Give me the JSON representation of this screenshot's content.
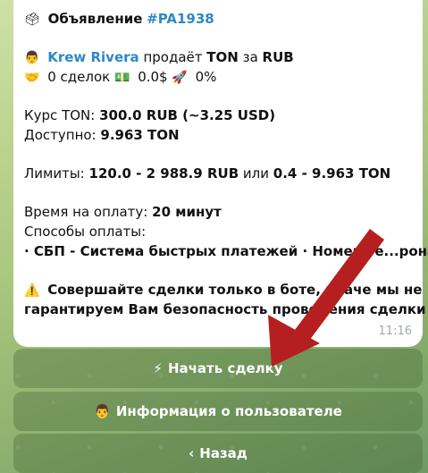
{
  "message": {
    "title_emoji": "🗳",
    "title_text": "Объявление",
    "title_tag": "#PA1938",
    "seller_emoji": "👨",
    "seller_name": "Krew Rivera",
    "sells_word": "продаёт",
    "currency": "TON",
    "for_word": "за",
    "fiat": "RUB",
    "stats_emoji": "🤝",
    "deals": "0 сделок",
    "volume_emoji": "💵",
    "volume": "0.0$",
    "rocket_emoji": "🚀",
    "rating": "0%",
    "rate_label": "Курс TON:",
    "rate_value": "300.0 RUB (~3.25 USD)",
    "available_label": "Доступно:",
    "available_value": "9.963 TON",
    "limits_label": "Лимиты:",
    "limits_rub": "120.0 - 2 988.9 RUB",
    "limits_or": "или",
    "limits_ton": "0.4 - 9.963 TON",
    "payment_time_label": "Время на оплату:",
    "payment_time_value": "20 минут",
    "methods_label": "Способы оплаты:",
    "methods_value": "· СБП - Система быстрых платежей · Номер те...рона",
    "warning_emoji": "⚠️",
    "warning_line1": "Совершайте сделки только в боте, иначе мы не",
    "warning_line2": "гарантируем Вам безопасность проведения сделки",
    "time": "11:16"
  },
  "keyboard": {
    "start_icon": "⚡",
    "start_label": "Начать сделку",
    "info_icon": "👨",
    "info_label": "Информация о пользователе",
    "back_icon": "‹",
    "back_label": "Назад"
  },
  "colors": {
    "link": "#2e88c9",
    "arrow": "#b51f1f"
  }
}
